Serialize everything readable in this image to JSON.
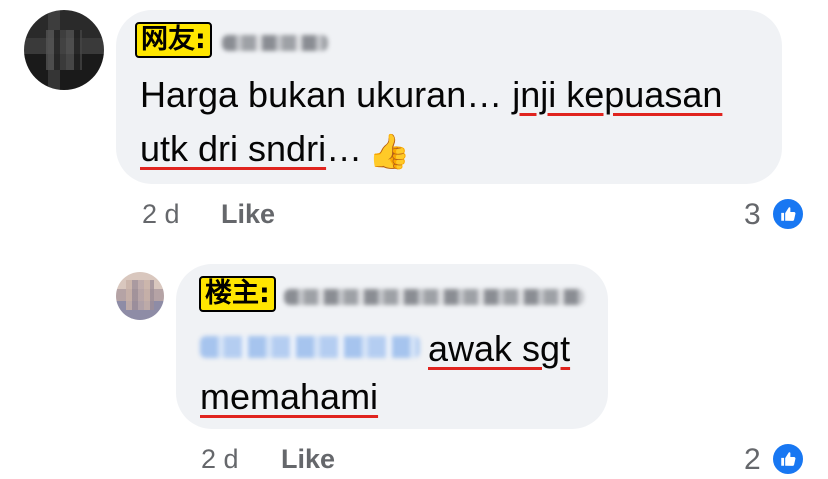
{
  "comments": [
    {
      "author_label": "网友:",
      "text_line1_plain": "Harga bukan ukuran… ",
      "text_line1_underlined": "jnji kepuasan",
      "text_line2_underlined": "utk dri sndri",
      "text_line2_plain": "…",
      "emoji": "👍",
      "time": "2 d",
      "like_label": "Like",
      "reaction_count": "3",
      "reaction_icon": "thumbs-up-icon"
    },
    {
      "author_label": "楼主:",
      "text_line1_underlined": "awak sgt",
      "text_line2_underlined": "memahami",
      "time": "2 d",
      "like_label": "Like",
      "reaction_count": "2",
      "reaction_icon": "thumbs-up-icon"
    }
  ],
  "colors": {
    "bubble": "#f0f2f5",
    "underline": "#e0241f",
    "label_highlight": "#ffe600",
    "like_blue": "#1877f2",
    "meta_grey": "#65676b"
  }
}
